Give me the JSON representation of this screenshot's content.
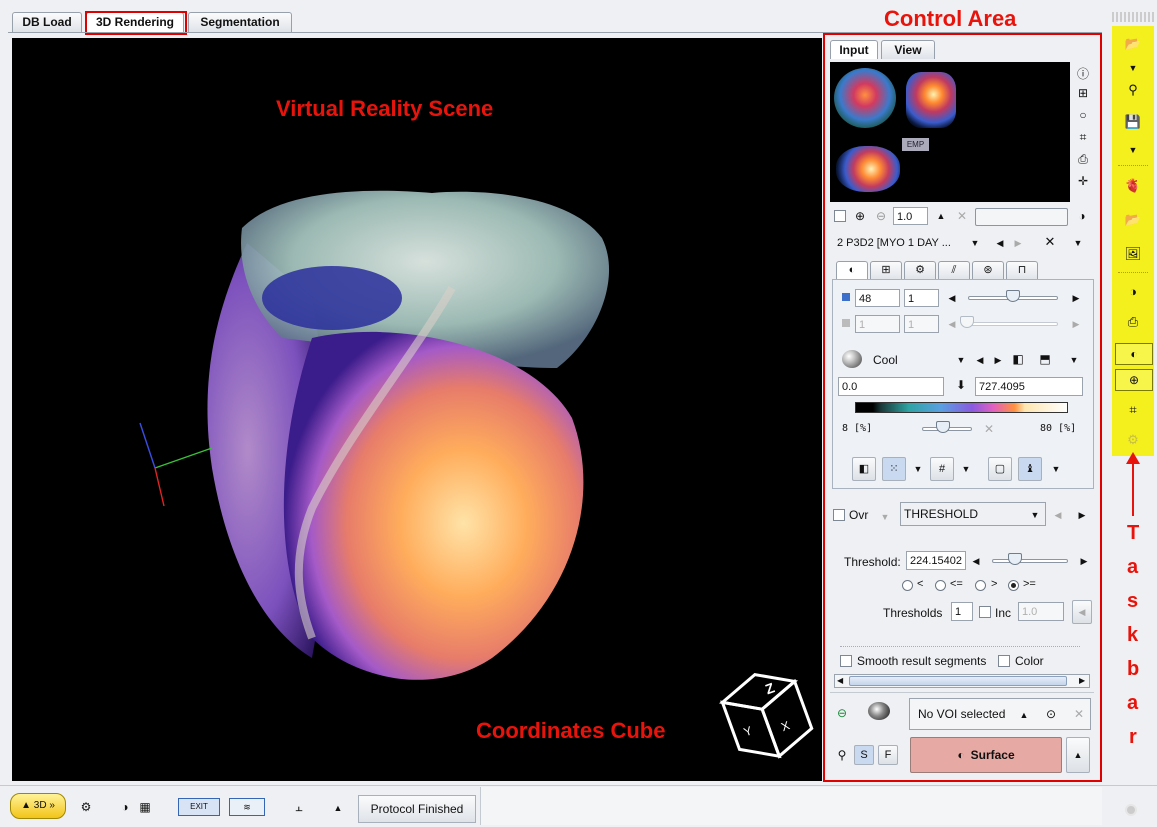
{
  "tabs": [
    {
      "label": "DB Load"
    },
    {
      "label": "3D Rendering"
    },
    {
      "label": "Segmentation"
    }
  ],
  "annotations": {
    "control_area": "Control Area",
    "virtual_reality_scene": "Virtual Reality Scene",
    "coordinates_cube": "Coordinates Cube",
    "taskbar_letters": [
      "T",
      "a",
      "s",
      "k",
      "b",
      "a",
      "r"
    ]
  },
  "control": {
    "tabs": [
      {
        "label": "Input"
      },
      {
        "label": "View"
      }
    ],
    "thumbnail_badge": "EMP",
    "zoom_value": "1.0",
    "series_selector": "2 P3D2 [MYO 1 DAY ...",
    "slice_value": "48",
    "slice_step": "1",
    "frame_value": "1",
    "frame_step": "1",
    "colormap": "Cool",
    "min_value": "0.0",
    "max_value": "727.4095",
    "lower_percent": "8 [%]",
    "upper_percent": "80 [%]",
    "ovr_label": "Ovr",
    "method": "THRESHOLD",
    "threshold_label": "Threshold:",
    "threshold_value": "224.15402",
    "radio_options": [
      "<",
      "<=",
      ">",
      ">="
    ],
    "thresholds_label": "Thresholds",
    "thresholds_value": "1",
    "inc_label": "Inc",
    "inc_value": "1.0",
    "smooth_label": "Smooth result segments",
    "color_label": "Color",
    "voi_selector": "No VOI selected",
    "s_label": "S",
    "f_label": "F",
    "surface_label": "Surface"
  },
  "statusbar": {
    "three_d_button": "▲ 3D »",
    "protocol_status": "Protocol Finished"
  },
  "colors": {
    "accent_red": "#e8140c",
    "taskbar_yellow": "#f4f01e",
    "surface_button": "#e7a9a3"
  }
}
